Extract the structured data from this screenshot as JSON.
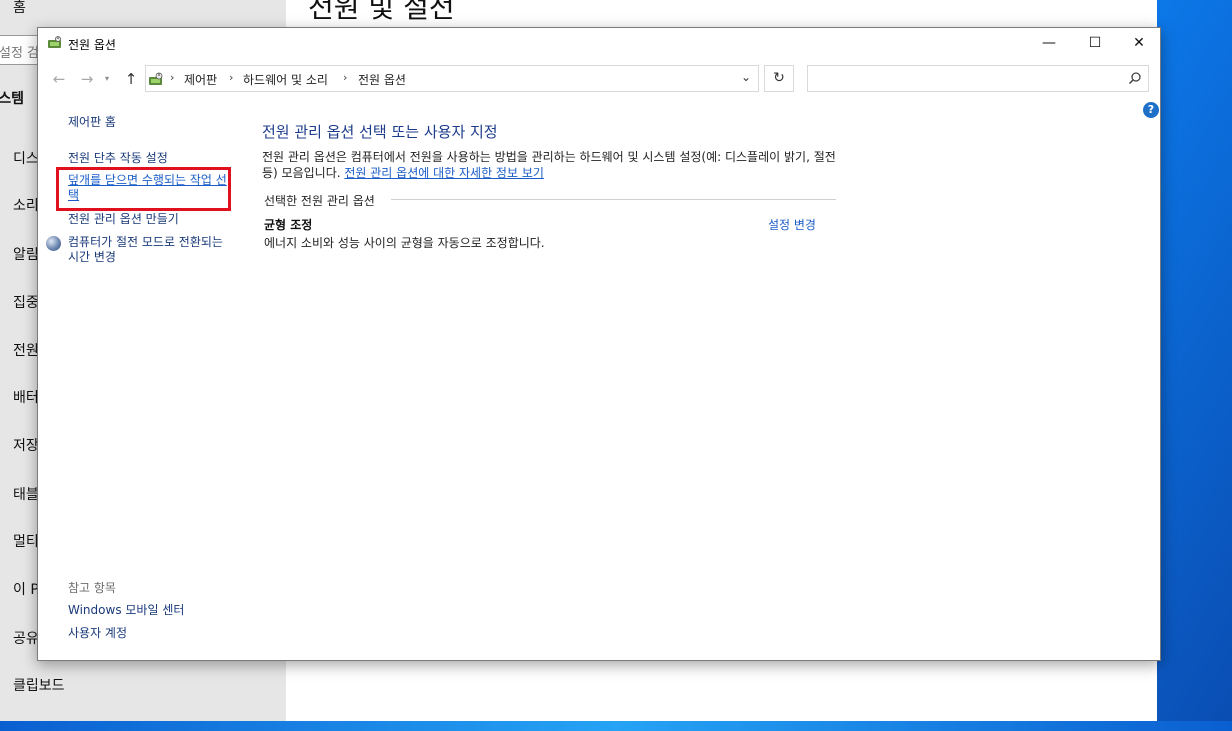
{
  "background_settings": {
    "home_label": "홈",
    "search_placeholder": "설정 검",
    "section_label": "스템",
    "page_title": "전원 및 절전",
    "nav_items": [
      "디스",
      "소리",
      "알림",
      "집중",
      "전원",
      "배터",
      "저장",
      "태블",
      "멀티",
      "이 P",
      "공유"
    ],
    "clipboard_label": "클립보드"
  },
  "window": {
    "title": "전원 옵션",
    "minimize_glyph": "—",
    "maximize_glyph": "☐",
    "close_glyph": "✕"
  },
  "navigation": {
    "back_glyph": "←",
    "forward_glyph": "→",
    "recent_glyph": "▾",
    "up_glyph": "↑",
    "breadcrumbs": [
      "제어판",
      "하드웨어 및 소리",
      "전원 옵션"
    ],
    "breadcrumb_separator": "›",
    "dropdown_glyph": "⌄",
    "refresh_glyph": "↻",
    "search_placeholder": ""
  },
  "help_glyph": "?",
  "left_pane": {
    "control_panel_home": "제어판 홈",
    "tasks": {
      "power_button": "전원 단추 작동 설정",
      "lid_close": "덮개를 닫으면 수행되는 작업 선택",
      "create_plan": "전원 관리 옵션 만들기",
      "sleep_time": "컴퓨터가 절전 모드로 전환되는 시간 변경"
    },
    "see_also": {
      "heading": "참고 항목",
      "windows_mobility": "Windows 모바일 센터",
      "user_accounts": "사용자 계정"
    }
  },
  "main": {
    "heading": "전원 관리 옵션 선택 또는 사용자 지정",
    "description": "전원 관리 옵션은 컴퓨터에서 전원을 사용하는 방법을 관리하는 하드웨어 및 시스템 설정(예: 디스플레이 밝기, 절전 등) 모음입니다. ",
    "description_link": "전원 관리 옵션에 대한 자세한 정보 보기",
    "selected_plan_label": "선택한 전원 관리 옵션",
    "plan": {
      "name": "균형 조정",
      "change_link": "설정 변경",
      "description": "에너지 소비와 성능 사이의 균형을 자동으로 조정합니다."
    }
  },
  "colors": {
    "link": "#1a5dc8",
    "heading": "#1e3c8c",
    "highlight": "#e0101e",
    "desktop": "#0a58c8"
  }
}
